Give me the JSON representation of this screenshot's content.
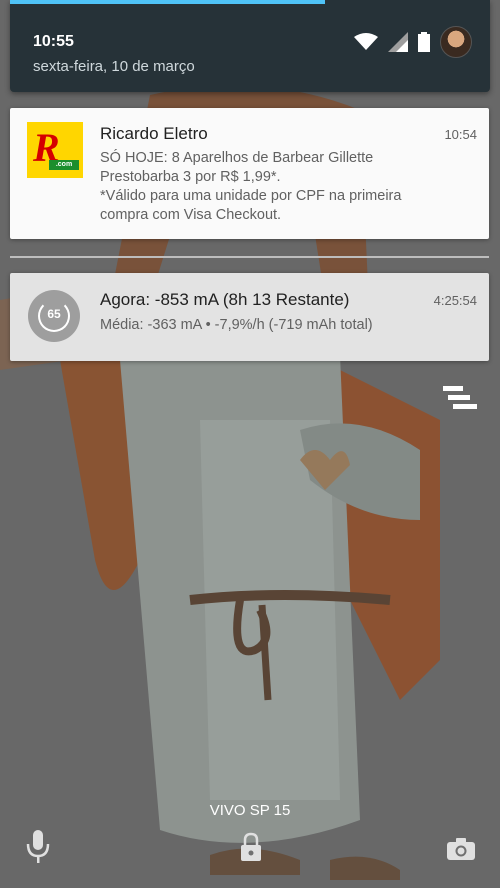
{
  "status": {
    "time": "10:55",
    "date": "sexta-feira, 10 de março",
    "icons": [
      "wifi-icon",
      "signal-icon",
      "battery-icon",
      "avatar"
    ]
  },
  "notifications": [
    {
      "app_title": "Ricardo Eletro",
      "time": "10:54",
      "body_lines": [
        "SÓ HOJE: 8 Aparelhos de Barbear Gillette",
        "Prestobarba 3 por R$ 1,99*.",
        "*Válido para uma unidade por CPF na primeira",
        "compra com Visa Checkout."
      ],
      "logo_letter": "R",
      "logo_small": ".com"
    },
    {
      "title": "Agora: -853 mA (8h 13 Restante)",
      "time": "4:25:54",
      "subtitle": "Média: -363 mA • -7,9%/h (-719 mAh total)",
      "icon_value": "65"
    }
  ],
  "lockscreen": {
    "carrier": "VIVO SP 15",
    "icons": [
      "microphone-icon",
      "lock-icon",
      "camera-icon"
    ]
  },
  "colors": {
    "header_bg": "#263238",
    "accent": "#4fc3f7",
    "card_bg": "#fafafa",
    "logo_yellow": "#ffd600",
    "logo_red": "#d50000"
  }
}
